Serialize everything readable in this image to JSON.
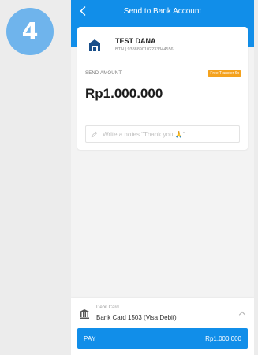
{
  "step": {
    "number": "4"
  },
  "header": {
    "title": "Send to Bank Account"
  },
  "recipient": {
    "name": "TEST DANA",
    "account": "BTN | 9388890102233344556"
  },
  "transfer": {
    "amount_label": "SEND AMOUNT",
    "free_badge": "Free Transfer 6x",
    "amount": "Rp1.000.000",
    "notes_placeholder": "Write a notes \"Thank you 🙏\""
  },
  "payment_method": {
    "type": "Debit Card",
    "name": "Bank Card 1503 (Visa Debit)"
  },
  "pay_button": {
    "label": "PAY",
    "amount": "Rp1.000.000"
  },
  "colors": {
    "primary": "#118ee9",
    "badge": "#f4a21e",
    "step_badge": "#6fb4ec"
  }
}
